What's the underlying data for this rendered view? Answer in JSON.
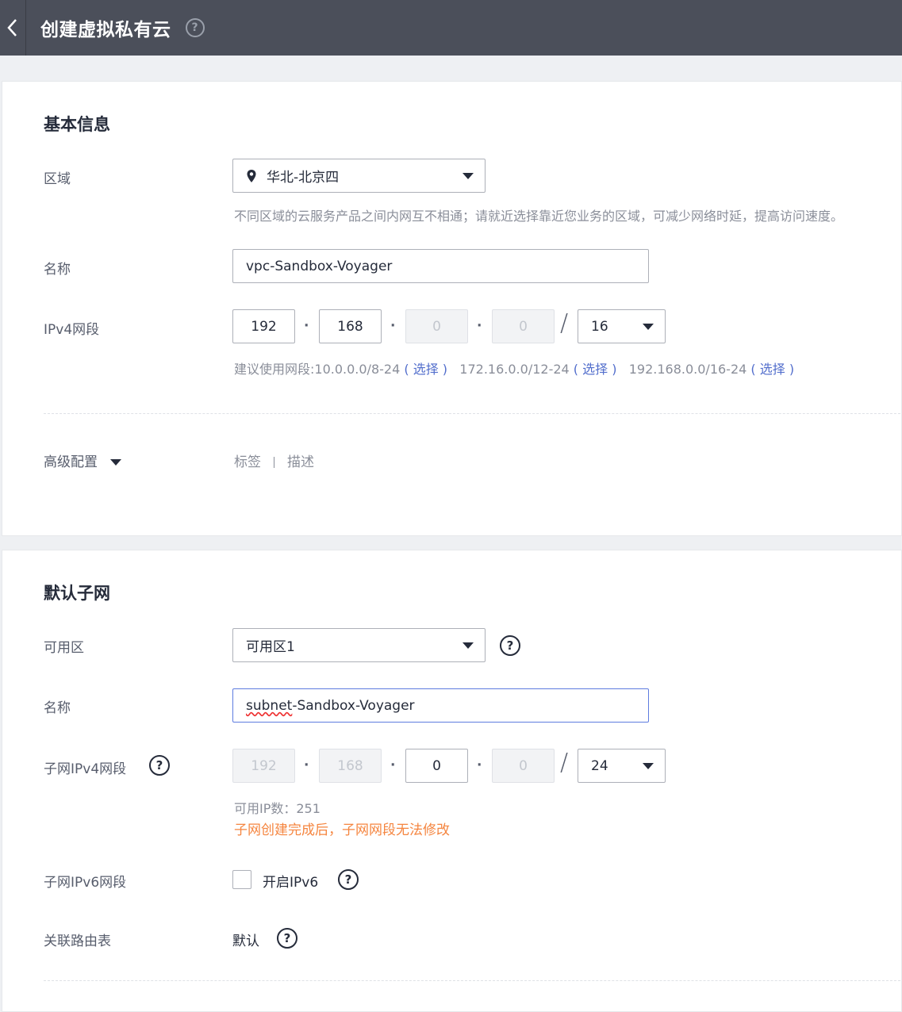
{
  "header": {
    "back_icon": "chevron-left-icon",
    "title": "创建虚拟私有云",
    "help_icon": "question-circle-icon"
  },
  "basic_info": {
    "section_title": "基本信息",
    "region": {
      "label": "区域",
      "value": "华北-北京四",
      "icon": "location-pin-icon",
      "hint": "不同区域的云服务产品之间内网互不相通；请就近选择靠近您业务的区域，可减少网络时延，提高访问速度。"
    },
    "name": {
      "label": "名称",
      "value": "vpc-Sandbox-Voyager"
    },
    "ipv4": {
      "label": "IPv4网段",
      "octets": [
        "192",
        "168",
        "0",
        "0"
      ],
      "mask": "16",
      "hint_prefix": "建议使用网段:10.0.0.0/8-24",
      "choose": "( 选择 )",
      "range2": "172.16.0.0/12-24",
      "range3": "192.168.0.0/16-24"
    },
    "advanced": {
      "label": "高级配置",
      "tag": "标签",
      "desc": "描述"
    }
  },
  "default_subnet": {
    "section_title": "默认子网",
    "az": {
      "label": "可用区",
      "value": "可用区1"
    },
    "name": {
      "label": "名称",
      "value_underlined": "subnet",
      "value_rest": "-Sandbox-Voyager"
    },
    "ipv4": {
      "label": "子网IPv4网段",
      "octets": [
        "192",
        "168",
        "0",
        "0"
      ],
      "mask": "24",
      "available_ips": "可用IP数：251",
      "warning": "子网创建完成后，子网网段无法修改"
    },
    "ipv6": {
      "label": "子网IPv6网段",
      "checkbox_label": "开启IPv6",
      "checked": false
    },
    "route_table": {
      "label": "关联路由表",
      "value": "默认"
    }
  },
  "colors": {
    "header_bg": "#4b4f5a",
    "link": "#526ecc",
    "warning": "#f5853f",
    "focus_border": "#5e7ce0"
  }
}
